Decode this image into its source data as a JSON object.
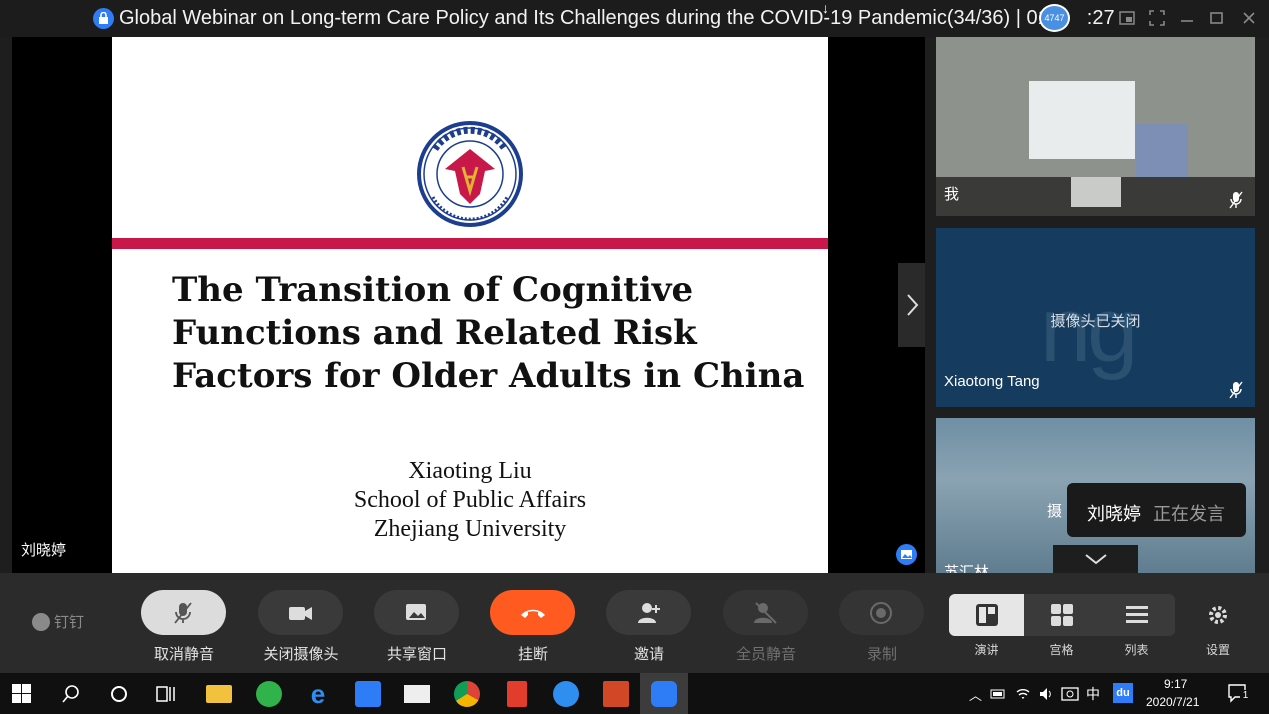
{
  "titlebar": {
    "title": "Global Webinar on Long-term Care Policy and Its Challenges during the COVID-19 Pandemic(34/36)",
    "timer_partial": "01",
    "timer_partial_end": ":27",
    "separator": "|",
    "bubble": "4747"
  },
  "slide": {
    "title_lines": [
      "The Transition of Cognitive",
      "Functions and Related Risk",
      "Factors for Older Adults in China"
    ],
    "author": "Xiaoting Liu",
    "affiliation": "School of Public Affairs",
    "university": "Zhejiang University",
    "logo_top_text": "浙江大学公共管理学院",
    "logo_bottom_text": "SCHOOL OF PUBLIC AFFAIRS ZHEJIANG UNIVERSITY",
    "accent_color": "#c8184a"
  },
  "main_stage": {
    "speaker_label": "刘晓婷"
  },
  "participants": [
    {
      "name": "我",
      "camera": "on"
    },
    {
      "name": "Xiaotong Tang",
      "camera_off_text": "摄像头已关闭",
      "ghost_text": "ng"
    },
    {
      "name_partial": "苏汇林",
      "overlay_partial": "摄"
    }
  ],
  "speaking_tooltip": {
    "name": "刘晓婷",
    "status": "正在发言"
  },
  "controls": {
    "brand": "钉钉",
    "buttons": [
      {
        "label": "取消静音",
        "icon": "mic-muted-icon"
      },
      {
        "label": "关闭摄像头",
        "icon": "camera-icon"
      },
      {
        "label": "共享窗口",
        "icon": "share-window-icon"
      },
      {
        "label": "挂断",
        "icon": "hangup-icon"
      },
      {
        "label": "邀请",
        "icon": "invite-icon"
      },
      {
        "label": "全员静音",
        "icon": "mute-all-icon"
      },
      {
        "label": "录制",
        "icon": "record-icon"
      }
    ],
    "views": [
      {
        "label": "演讲",
        "active": true
      },
      {
        "label": "宫格",
        "active": false
      },
      {
        "label": "列表",
        "active": false
      }
    ],
    "settings_label": "设置"
  },
  "taskbar": {
    "time": "9:17",
    "date": "2020/7/21",
    "ime": "中",
    "notification_count": "1",
    "baidu": "du"
  }
}
